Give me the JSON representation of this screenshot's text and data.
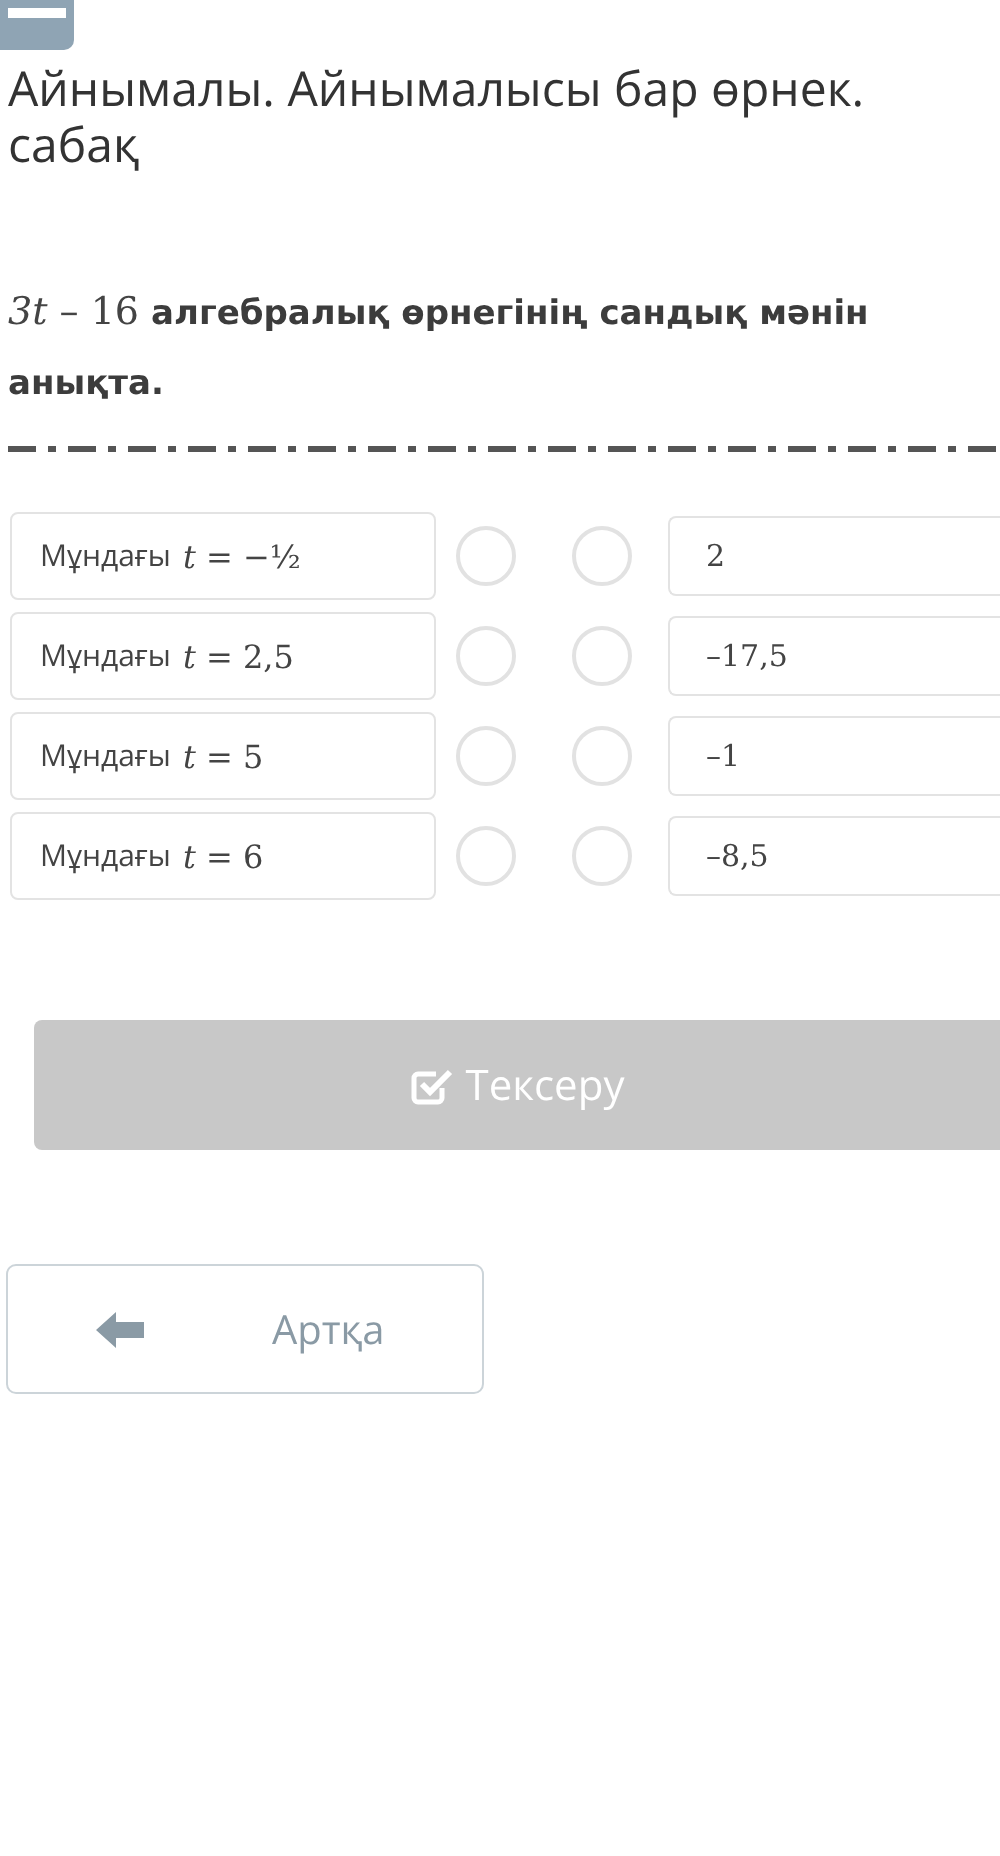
{
  "header": {
    "title_lines": [
      "Айнымалы. Айнымалысы бар өрнек.",
      "сабақ"
    ]
  },
  "question": {
    "text": "*3t* – 16 **алгебралық өрнегінің сандық мәнін анықта.**"
  },
  "left_items": [
    {
      "label": "Мұндағы",
      "math": "*t* = −½",
      "selected": false
    },
    {
      "label": "Мұндағы",
      "math": "*t* = 2,5",
      "selected": false
    },
    {
      "label": "Мұндағы",
      "math": "*t* = 5",
      "selected": false
    },
    {
      "label": "Мұндағы",
      "math": "*t* = 6",
      "selected": false
    }
  ],
  "right_items": [
    {
      "value": "2",
      "selected": false
    },
    {
      "value": "–17,5",
      "selected": false
    },
    {
      "value": "–1",
      "selected": false
    },
    {
      "value": "–8,5",
      "selected": false
    }
  ],
  "check_button": {
    "label": "Тексеру",
    "disabled": true
  },
  "back_button": {
    "label": "Артқа"
  }
}
